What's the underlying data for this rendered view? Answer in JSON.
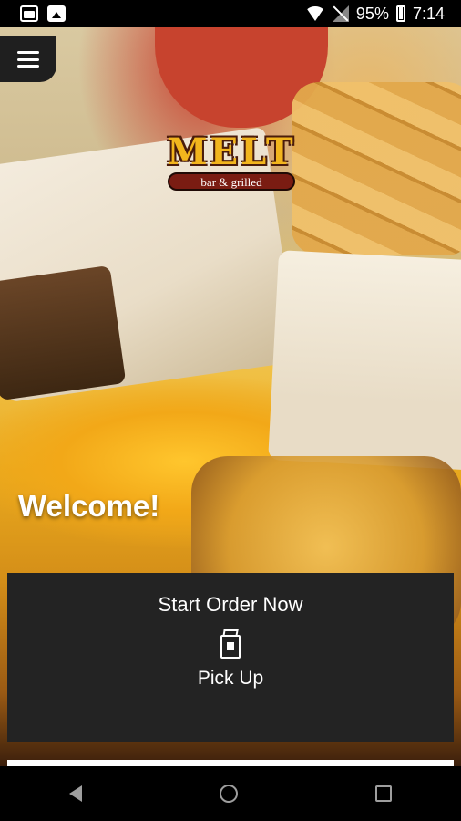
{
  "status_bar": {
    "battery": "95%",
    "time": "7:14",
    "icons": [
      "folder-icon",
      "image-icon",
      "wifi-icon",
      "no-signal-icon",
      "battery-icon"
    ]
  },
  "logo": {
    "name": "MELT",
    "tagline": "bar & grilled"
  },
  "hero": {
    "welcome": "Welcome!"
  },
  "order_card": {
    "title": "Start Order Now",
    "icon": "bag-icon",
    "option_label": "Pick Up"
  },
  "nav": {
    "icons": [
      "back-icon",
      "home-icon",
      "recents-icon"
    ]
  },
  "colors": {
    "card_bg": "#232323",
    "logo_gold": "#f2b51d",
    "logo_red": "#7a1c12"
  }
}
